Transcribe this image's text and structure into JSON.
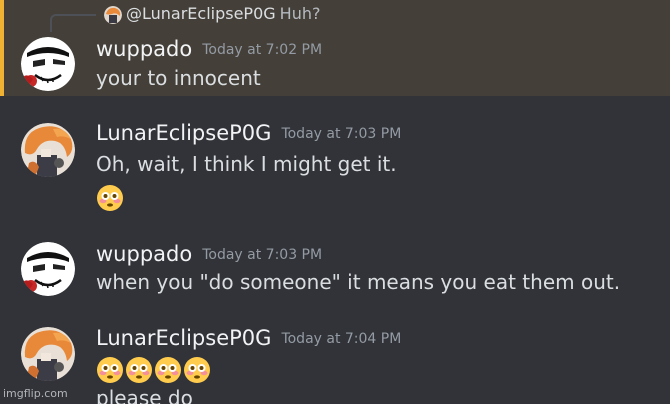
{
  "reply": {
    "username": "@LunarEclipseP0G",
    "text": "Huh?"
  },
  "messages": [
    {
      "username": "wuppado",
      "timestamp": "Today at 7:02 PM",
      "lines": [
        "your to innocent"
      ],
      "highlighted": true
    },
    {
      "username": "LunarEclipseP0G",
      "timestamp": "Today at 7:03 PM",
      "lines": [
        "Oh, wait, I think I might get it."
      ],
      "emoji_count": 1
    },
    {
      "username": "wuppado",
      "timestamp": "Today at 7:03 PM",
      "lines": [
        "when you \"do someone\" it means you eat them out."
      ]
    },
    {
      "username": "LunarEclipseP0G",
      "timestamp": "Today at 7:04 PM",
      "lines": [
        "please do"
      ],
      "emoji_count": 4
    }
  ],
  "watermark": "imgflip.com",
  "icons": {
    "emoji": "flushed-face-emoji",
    "avatar_wuppado": "white-face-avatar",
    "avatar_lunar": "orange-hair-avatar"
  },
  "colors": {
    "background": "#313338",
    "highlight_background": "#444039",
    "highlight_bar": "#f0b232",
    "username": "#f2f3f5",
    "timestamp": "#949ba4",
    "message_text": "#dbdee1"
  }
}
